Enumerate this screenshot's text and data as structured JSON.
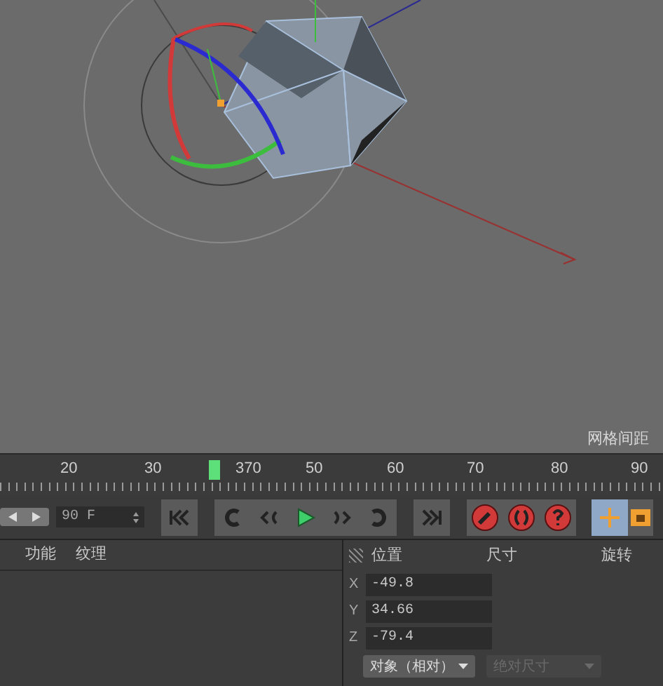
{
  "viewport": {
    "grid_label": "网格间距"
  },
  "timeline": {
    "ticks": [
      "20",
      "30",
      "370",
      "50",
      "60",
      "70",
      "80",
      "90"
    ],
    "level": 0.36
  },
  "transport": {
    "frame_field": "90 F",
    "play_selected": true
  },
  "tool_buttons": [
    {
      "kind": "move",
      "selected": true
    },
    {
      "kind": "scale",
      "selected": false
    }
  ],
  "material_panel": {
    "tabs": [
      "功能",
      "纹理"
    ]
  },
  "coord_panel": {
    "headers": [
      "位置",
      "尺寸",
      "旋转"
    ],
    "rows": [
      {
        "axis": "X",
        "value": "-49.8"
      },
      {
        "axis": "Y",
        "value": "34.66"
      },
      {
        "axis": "Z",
        "value": "-79.4"
      }
    ],
    "mode_dropdown": "对象（相对）",
    "size_dropdown": {
      "label": "绝对尺寸",
      "disabled": true
    }
  }
}
